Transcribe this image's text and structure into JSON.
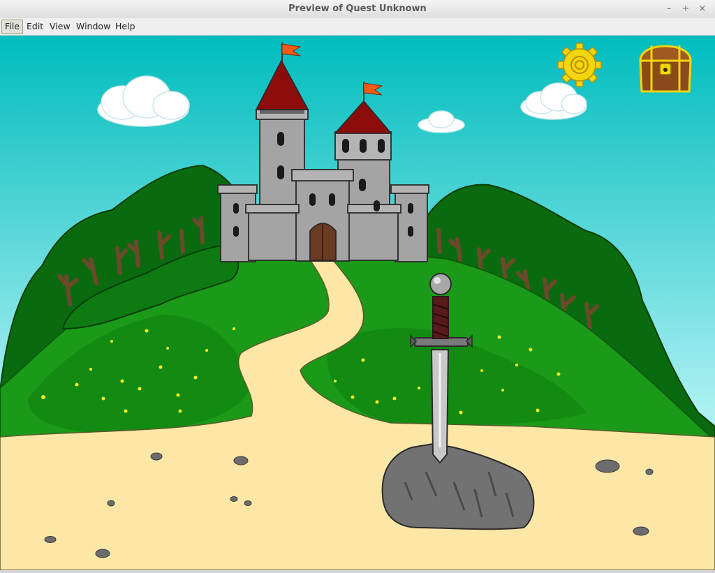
{
  "window": {
    "title": "Preview of Quest Unknown",
    "controls": {
      "minimize": "–",
      "maximize": "+",
      "close": "×"
    }
  },
  "menubar": {
    "items": [
      {
        "label": "File",
        "active": true
      },
      {
        "label": "Edit"
      },
      {
        "label": "View"
      },
      {
        "label": "Window"
      },
      {
        "label": "Help"
      }
    ]
  },
  "scene": {
    "colors": {
      "sky_top": "#00bcbd",
      "sky_bottom": "#b8f4f6",
      "hill_dark": "#0a6a10",
      "hill_light": "#1a9a18",
      "path": "#fce7a6",
      "castle_stone": "#a4a4a4",
      "roof": "#8c0c0c",
      "flag": "#f05a14",
      "gear": "#f3d60c",
      "chest": "#8a4a1a"
    },
    "icons": {
      "settings": "gear-icon",
      "inventory": "treasure-chest-icon"
    }
  }
}
